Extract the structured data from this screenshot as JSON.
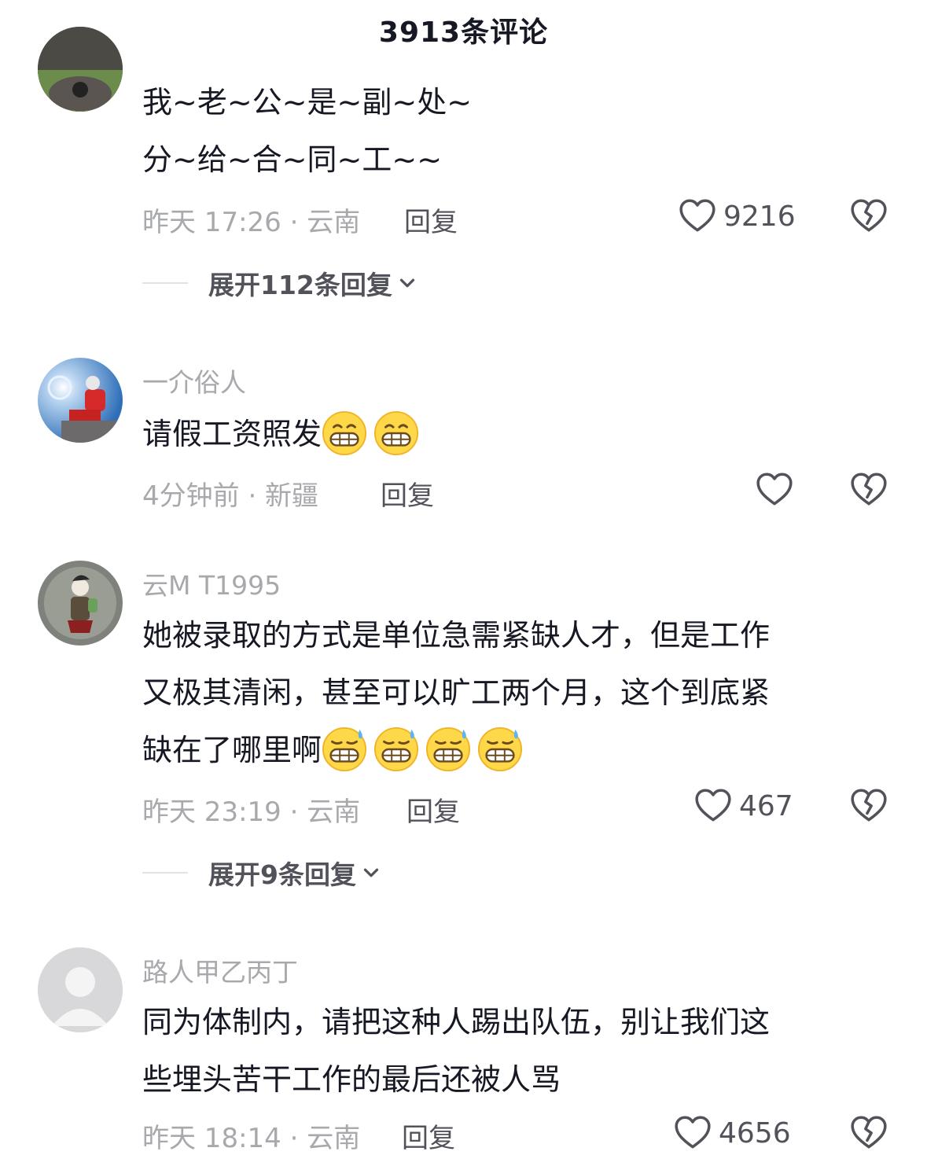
{
  "header": {
    "title": "3913条评论"
  },
  "comments": [
    {
      "username": "",
      "lines": [
        "我~老~公~是~副~处~",
        "分~给~合~同~工~~"
      ],
      "emojis": [],
      "time_location": "昨天 17:26 · 云南",
      "reply_label": "回复",
      "like_count": "9216",
      "expand_label": "展开112条回复"
    },
    {
      "username": "一介俗人",
      "lines": [
        "请假工资照发"
      ],
      "emojis": [
        "grin-emoji",
        "grin-emoji"
      ],
      "time_location": "4分钟前 · 新疆",
      "reply_label": "回复",
      "like_count": "",
      "expand_label": ""
    },
    {
      "username": "云M T1995",
      "lines": [
        "她被录取的方式是单位急需紧缺人才，但是工作",
        "又极其清闲，甚至可以旷工两个月，这个到底紧",
        "缺在了哪里啊"
      ],
      "emojis": [
        "sweat-grin-emoji",
        "sweat-grin-emoji",
        "sweat-grin-emoji",
        "sweat-grin-emoji"
      ],
      "time_location": "昨天 23:19 · 云南",
      "reply_label": "回复",
      "like_count": "467",
      "expand_label": "展开9条回复"
    },
    {
      "username": "路人甲乙丙丁",
      "lines": [
        "同为体制内，请把这种人踢出队伍，别让我们这",
        "些埋头苦干工作的最后还被人骂"
      ],
      "emojis": [],
      "time_location": "昨天 18:14 · 云南",
      "reply_label": "回复",
      "like_count": "4656",
      "expand_label": ""
    }
  ]
}
